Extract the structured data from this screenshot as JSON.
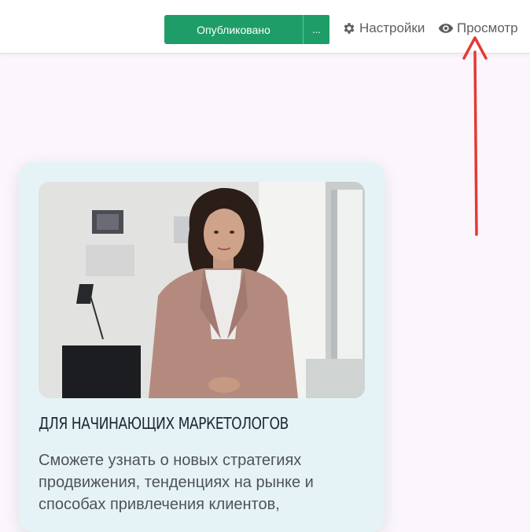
{
  "toolbar": {
    "publish_label": "Опубликовано",
    "more_label": "...",
    "settings_label": "Настройки",
    "settings_icon": "gear-icon",
    "preview_label": "Просмотр",
    "preview_icon": "eye-icon"
  },
  "card": {
    "title": "ДЛЯ НАЧИНАЮЩИХ МАРКЕТОЛОГОВ",
    "text": "Сможете узнать о новых стратегиях продвижения, тенденциях на рынке и способах привлечения клиентов,"
  },
  "colors": {
    "accent": "#1f9d68",
    "annotation_arrow": "#e53935",
    "card_bg": "#e5f3f6"
  }
}
